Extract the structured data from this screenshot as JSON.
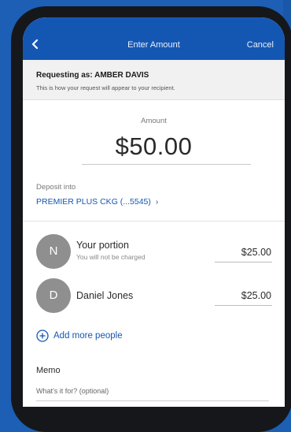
{
  "header": {
    "title": "Enter Amount",
    "cancel_label": "Cancel",
    "back_icon": "chevron-left-icon"
  },
  "request": {
    "prefix": "Requesting as: ",
    "name": "AMBER DAVIS",
    "note": "This is how your request will appear to your recipient."
  },
  "amount": {
    "label": "Amount",
    "value": "$50.00"
  },
  "deposit": {
    "label": "Deposit into",
    "account": "PREMIER PLUS CKG (...5545)",
    "chevron": "›"
  },
  "people": [
    {
      "initial": "N",
      "name": "Your portion",
      "subtitle": "You will not be charged",
      "amount": "$25.00"
    },
    {
      "initial": "D",
      "name": "Daniel Jones",
      "subtitle": "",
      "amount": "$25.00"
    }
  ],
  "add_people_label": "Add more people",
  "memo": {
    "label": "Memo",
    "placeholder": "What's it for? (optional)"
  },
  "colors": {
    "brand_blue": "#1457b3",
    "avatar_gray": "#8f8f8f"
  }
}
